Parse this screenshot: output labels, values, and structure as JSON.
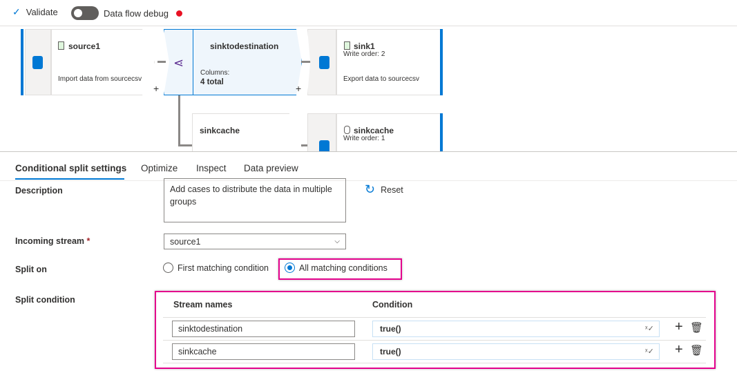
{
  "toolbar": {
    "validate_label": "Validate",
    "debug_label": "Data flow debug",
    "debug_on": false,
    "debug_status_color": "#e81123"
  },
  "canvas": {
    "source": {
      "title": "source1",
      "description": "Import data from sourcecsv"
    },
    "split": {
      "title": "sinktodestination",
      "columns_label": "Columns:",
      "columns_value": "4 total"
    },
    "sink1": {
      "title": "sink1",
      "write_order": "Write order: 2",
      "description": "Export data to sourcecsv"
    },
    "split2": {
      "title": "sinkcache"
    },
    "sink2": {
      "title": "sinkcache",
      "write_order": "Write order: 1"
    },
    "plus": "+"
  },
  "tabs": [
    {
      "label": "Conditional split settings",
      "active": true
    },
    {
      "label": "Optimize"
    },
    {
      "label": "Inspect"
    },
    {
      "label": "Data preview"
    }
  ],
  "form": {
    "description_label": "Description",
    "description_value": "Add cases to distribute the data in multiple groups",
    "reset_label": "Reset",
    "incoming_label": "Incoming stream",
    "required_mark": "*",
    "incoming_value": "source1",
    "split_on_label": "Split on",
    "split_options": [
      "First matching condition",
      "All matching conditions"
    ],
    "split_selected": "All matching conditions",
    "split_condition_label": "Split condition",
    "table": {
      "headers": [
        "Stream names",
        "Condition"
      ],
      "rows": [
        {
          "name": "sinktodestination",
          "condition": "true()"
        },
        {
          "name": "sinkcache",
          "condition": "true()"
        }
      ]
    }
  },
  "colors": {
    "accent": "#0078d4",
    "highlight": "#e3008c"
  }
}
